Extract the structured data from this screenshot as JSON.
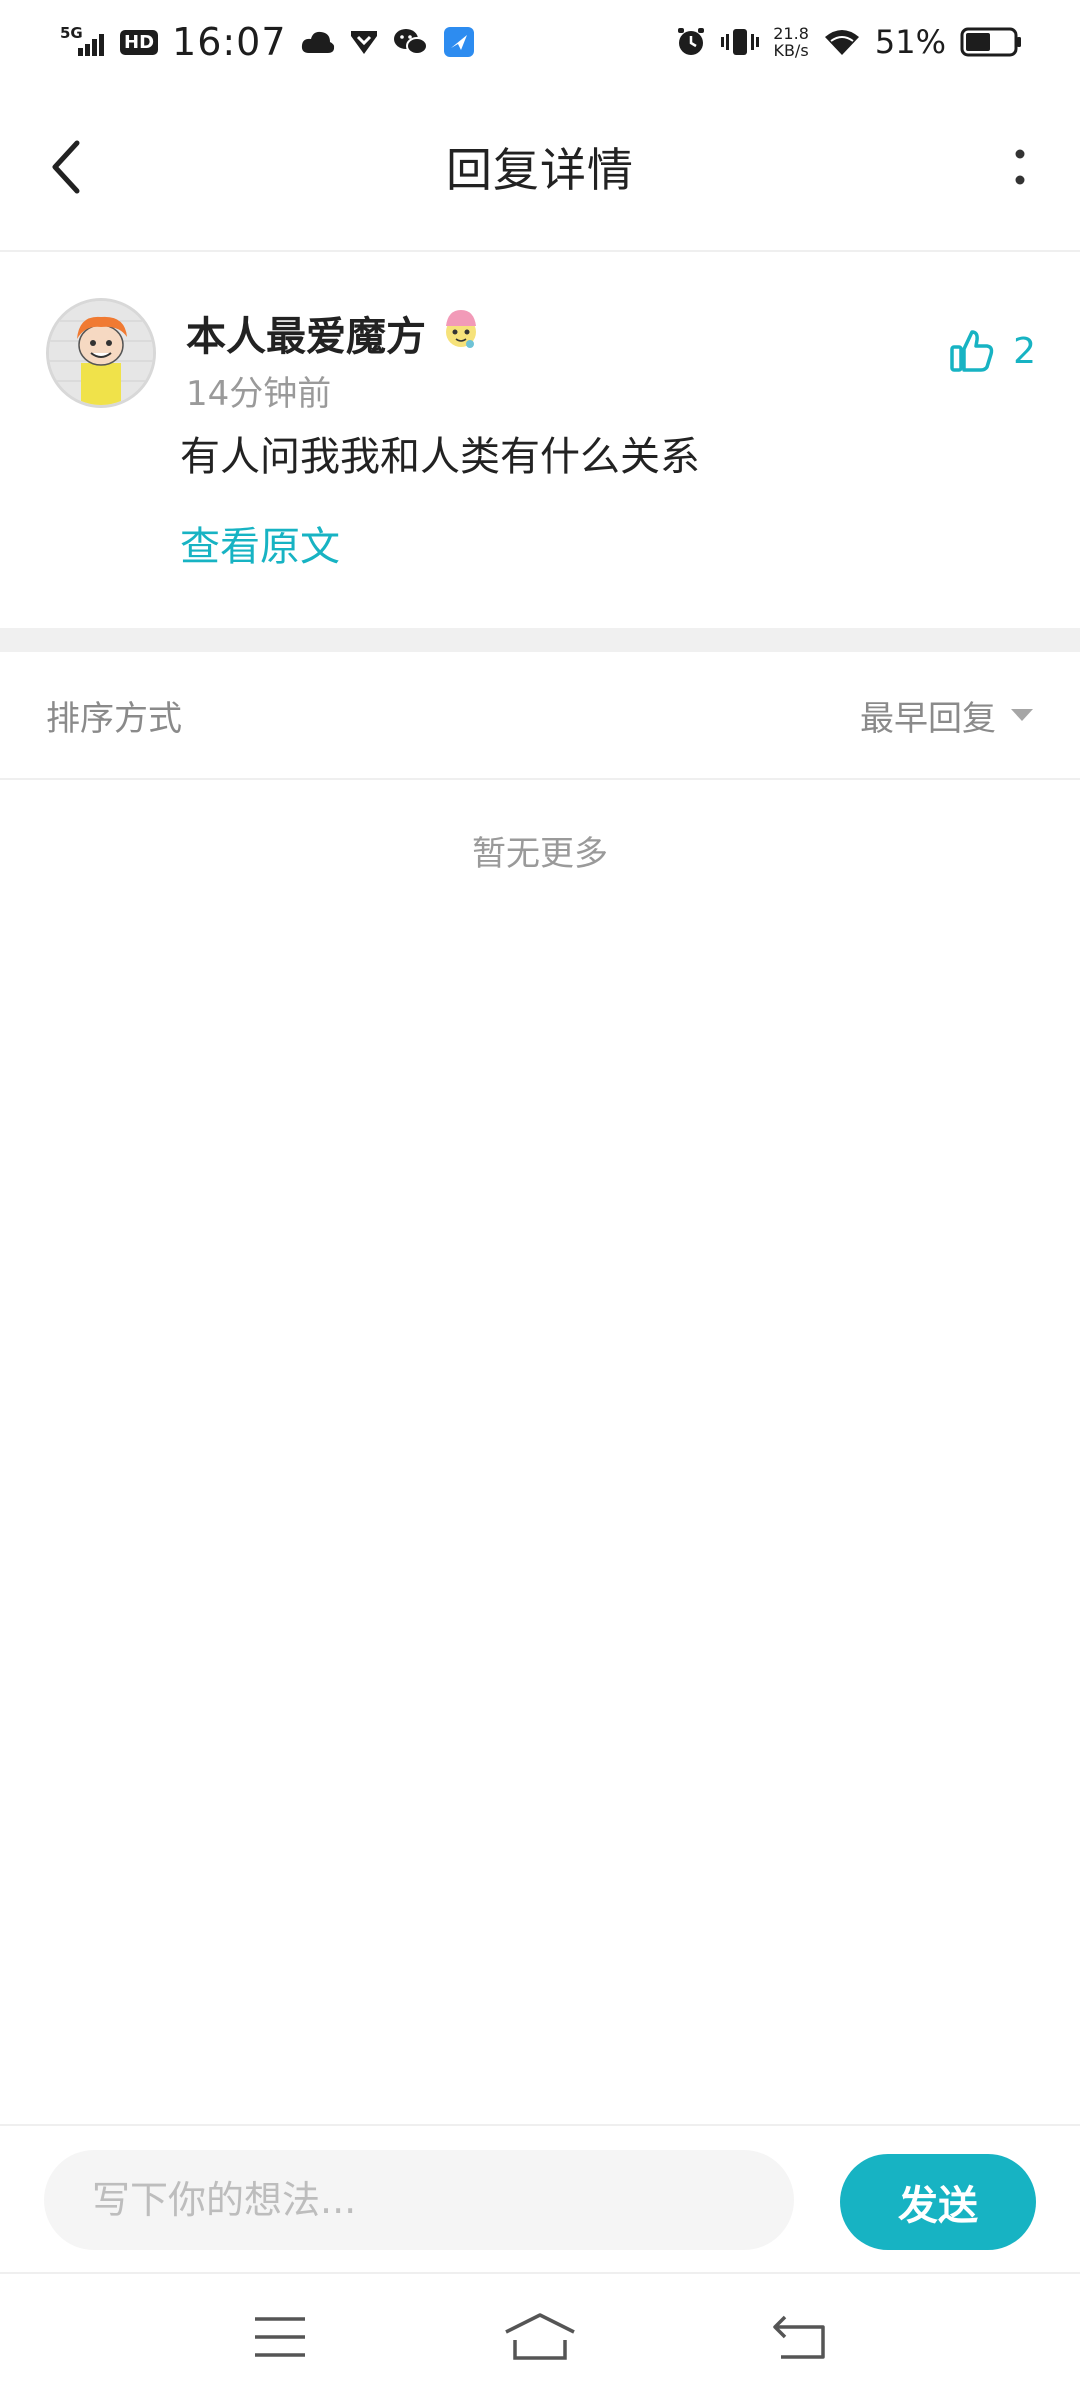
{
  "status_bar": {
    "network": "5G",
    "hd": "HD",
    "time": "16:07",
    "speed_value": "21.8",
    "speed_unit": "KB/s",
    "battery": "51%",
    "icons": [
      "signal-icon",
      "cloud-icon",
      "heart-shield-icon",
      "wechat-icon",
      "app-notification-icon",
      "alarm-icon",
      "vibrate-icon",
      "wifi-icon",
      "battery-icon"
    ]
  },
  "header": {
    "title": "回复详情",
    "back_icon": "chevron-left-icon",
    "more_icon": "more-vertical-icon"
  },
  "comment": {
    "username": "本人最爱魔方",
    "time_ago": "14分钟前",
    "content": "有人问我我和人类有什么关系",
    "view_original": "查看原文",
    "like_count": "2"
  },
  "sort": {
    "label": "排序方式",
    "selected": "最早回复"
  },
  "empty_text": "暂无更多",
  "composer": {
    "placeholder": "写下你的想法...",
    "send_label": "发送"
  },
  "colors": {
    "accent": "#17b3c3",
    "muted_text": "#9a9a9a",
    "divider": "#f0f0f0"
  }
}
